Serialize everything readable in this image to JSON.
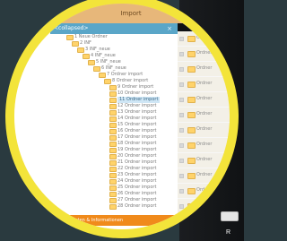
{
  "app": {
    "title": "Import"
  },
  "left_panel": {
    "header": "<collapsed>",
    "close": "×",
    "tree_items": [
      "1 Neue Ordner",
      "2 INF",
      "3 INF_neue",
      "4 INF_neue",
      "5 INF_neue",
      "6 INF_neue",
      "7 Ordner import",
      "8 Ordner import",
      "9 Ordner import",
      "10 Ordner import",
      "11 Ordner import",
      "12 Ordner import",
      "13 Ordner import",
      "14 Ordner import",
      "15 Ordner import",
      "16 Ordner import",
      "17 Ordner import",
      "18 Ordner import",
      "19 Ordner import",
      "20 Ordner import",
      "21 Ordner import",
      "22 Ordner import",
      "23 Ordner import",
      "24 Ordner import",
      "25 Ordner import",
      "26 Ordner import",
      "27 Ordner import",
      "28 Ordner import"
    ],
    "selected_index": 10,
    "footer": "Update Daten & Informationen"
  },
  "right_panel": {
    "rows": [
      "Ordner",
      "Ordner",
      "Ordner",
      "Ordner",
      "Ordner",
      "Ordner",
      "Ordner",
      "Ordner",
      "Ordner",
      "Ordner",
      "Ordner",
      "Ordner"
    ],
    "status_letter": "R"
  }
}
